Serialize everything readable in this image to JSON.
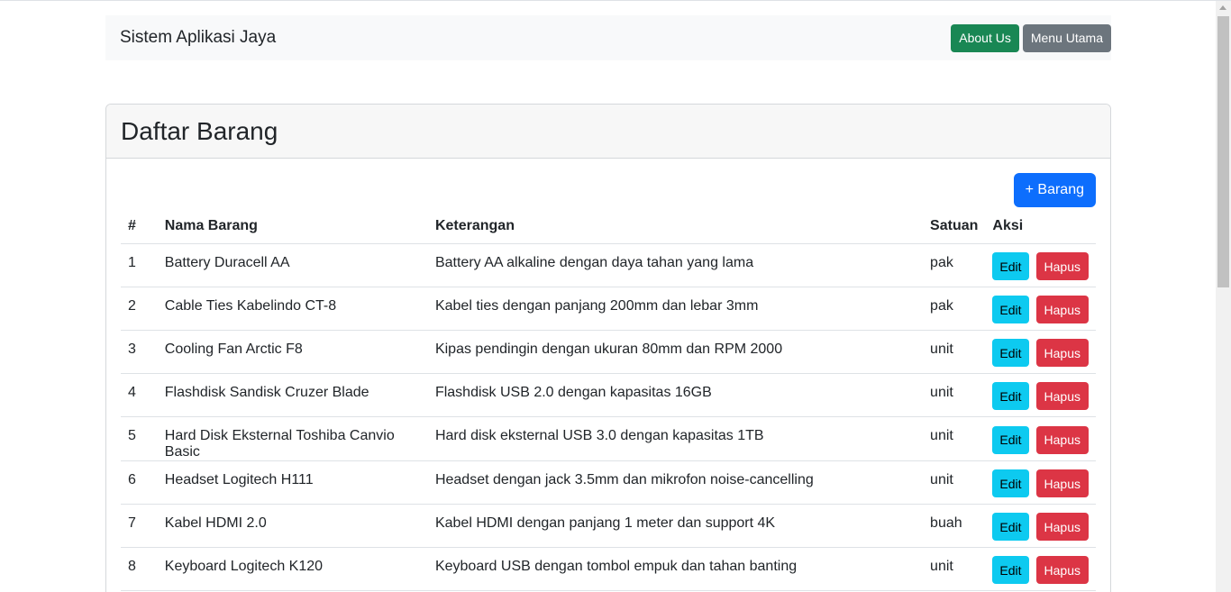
{
  "navbar": {
    "brand": "Sistem Aplikasi Jaya",
    "about_label": "About Us",
    "menu_label": "Menu Utama",
    "about_color": "#198754",
    "menu_color": "#6c757d"
  },
  "card": {
    "title": "Daftar Barang",
    "add_button_label": "+ Barang"
  },
  "table": {
    "headers": {
      "no": "#",
      "name": "Nama Barang",
      "desc": "Keterangan",
      "unit": "Satuan",
      "action": "Aksi"
    },
    "edit_label": "Edit",
    "delete_label": "Hapus",
    "rows": [
      {
        "no": "1",
        "name": "Battery Duracell AA",
        "desc": "Battery AA alkaline dengan daya tahan yang lama",
        "unit": "pak"
      },
      {
        "no": "2",
        "name": "Cable Ties Kabelindo CT-8",
        "desc": "Kabel ties dengan panjang 200mm dan lebar 3mm",
        "unit": "pak"
      },
      {
        "no": "3",
        "name": "Cooling Fan Arctic F8",
        "desc": "Kipas pendingin dengan ukuran 80mm dan RPM 2000",
        "unit": "unit"
      },
      {
        "no": "4",
        "name": "Flashdisk Sandisk Cruzer Blade",
        "desc": "Flashdisk USB 2.0 dengan kapasitas 16GB",
        "unit": "unit"
      },
      {
        "no": "5",
        "name": "Hard Disk Eksternal Toshiba Canvio Basic",
        "desc": "Hard disk eksternal USB 3.0 dengan kapasitas 1TB",
        "unit": "unit"
      },
      {
        "no": "6",
        "name": "Headset Logitech H111",
        "desc": "Headset dengan jack 3.5mm dan mikrofon noise-cancelling",
        "unit": "unit"
      },
      {
        "no": "7",
        "name": "Kabel HDMI 2.0",
        "desc": "Kabel HDMI dengan panjang 1 meter dan support 4K",
        "unit": "buah"
      },
      {
        "no": "8",
        "name": "Keyboard Logitech K120",
        "desc": "Keyboard USB dengan tombol empuk dan tahan banting",
        "unit": "unit"
      }
    ]
  },
  "colors": {
    "primary": "#0d6efd",
    "edit": "#0dcaf0",
    "delete": "#dc3545"
  }
}
